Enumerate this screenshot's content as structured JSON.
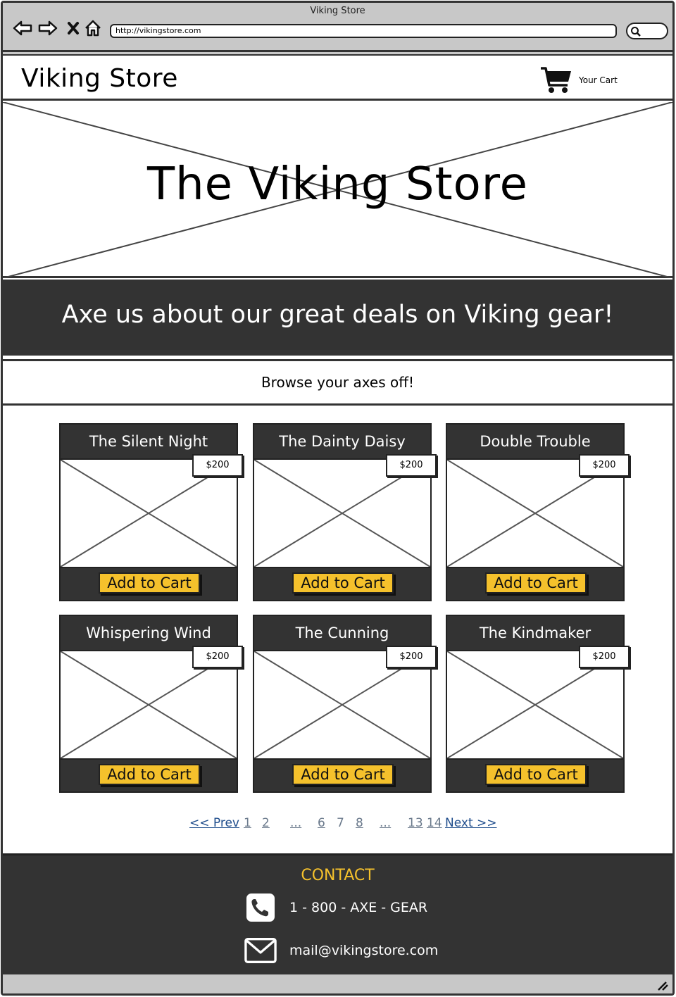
{
  "window": {
    "title": "Viking Store",
    "url": "http://vikingstore.com"
  },
  "header": {
    "logo": "Viking Store",
    "cart_label": "Your Cart",
    "cart_icon": "shopping-cart-icon"
  },
  "hero": {
    "title": "The Viking Store"
  },
  "banner": {
    "text": "Axe us about our great deals on Viking gear!"
  },
  "browse": {
    "text": "Browse your axes off!"
  },
  "products": [
    {
      "name": "The Silent Night",
      "price": "$200",
      "button": "Add to Cart"
    },
    {
      "name": "The Dainty Daisy",
      "price": "$200",
      "button": "Add to Cart"
    },
    {
      "name": "Double Trouble",
      "price": "$200",
      "button": "Add to Cart"
    },
    {
      "name": "Whispering Wind",
      "price": "$200",
      "button": "Add to Cart"
    },
    {
      "name": "The Cunning",
      "price": "$200",
      "button": "Add to Cart"
    },
    {
      "name": "The Kindmaker",
      "price": "$200",
      "button": "Add to Cart"
    }
  ],
  "pagination": {
    "prev": "<< Prev",
    "pages": [
      "1",
      "2",
      "...",
      "6",
      "7",
      "8",
      "...",
      "13",
      "14"
    ],
    "next": "Next >>"
  },
  "footer": {
    "contact_title": "CONTACT",
    "phone": "1 - 800 - AXE - GEAR",
    "email": "mail@vikingstore.com"
  },
  "colors": {
    "accent": "#f5c12c",
    "dark": "#333333",
    "link": "#1f4d8c"
  }
}
